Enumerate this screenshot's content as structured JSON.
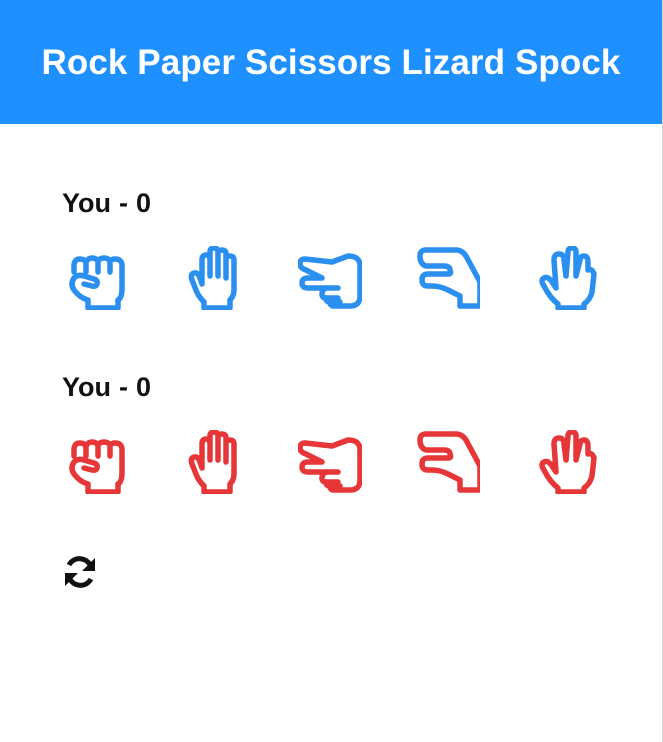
{
  "header": {
    "title": "Rock Paper Scissors Lizard Spock"
  },
  "players": [
    {
      "label": "You",
      "score": "0",
      "color": "#2b8ff0",
      "hands": [
        "rock",
        "paper",
        "scissors",
        "lizard",
        "spock"
      ]
    },
    {
      "label": "You",
      "score": "0",
      "color": "#e63638",
      "hands": [
        "rock",
        "paper",
        "scissors",
        "lizard",
        "spock"
      ]
    }
  ],
  "icons": {
    "rock": "hand-rock-icon",
    "paper": "hand-paper-icon",
    "scissors": "hand-scissors-icon",
    "lizard": "hand-lizard-icon",
    "spock": "hand-spock-icon",
    "reset": "refresh-icon"
  },
  "colors": {
    "header_bg": "#1e90ff",
    "header_text": "#ffffff"
  }
}
